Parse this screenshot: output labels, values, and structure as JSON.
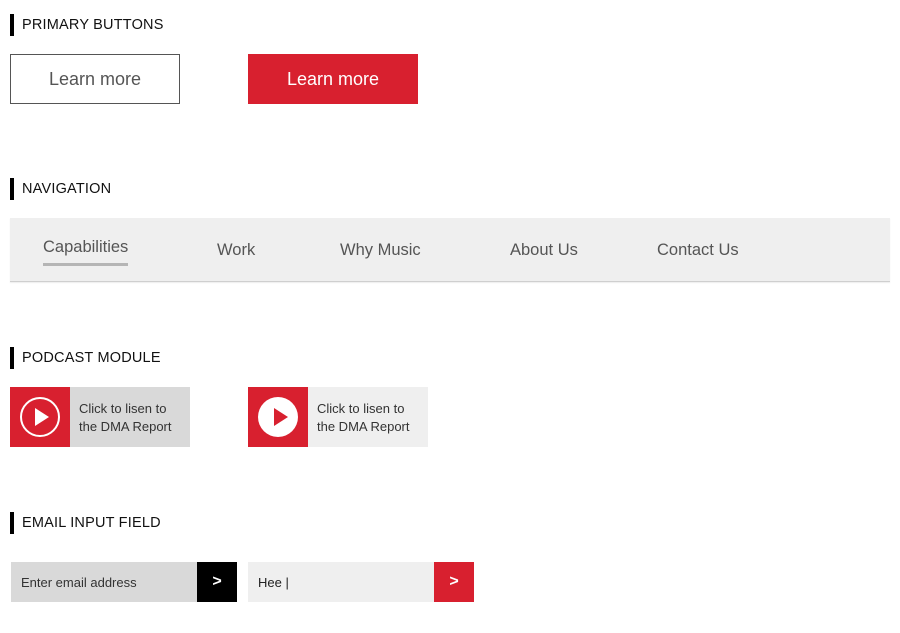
{
  "sections": {
    "primary_buttons": "PRIMARY BUTTONS",
    "navigation": "NAVIGATION",
    "podcast_module": "PODCAST MODULE",
    "email_input_field": "EMAIL INPUT FIELD"
  },
  "buttons": {
    "outline_label": "Learn more",
    "solid_label": "Learn more"
  },
  "navigation": {
    "items": [
      "Capabilities",
      "Work",
      "Why Music",
      "About Us",
      "Contact Us"
    ],
    "active_index": 0
  },
  "podcast": {
    "line1": "Click to lisen to",
    "line2": "the DMA Report",
    "icons": [
      "play-outline-icon",
      "play-filled-icon"
    ]
  },
  "email": {
    "placeholder": "Enter email address",
    "typed_value": "Hee |",
    "submit_glyph": ">"
  },
  "colors": {
    "accent_red": "#d8202f",
    "black": "#000000",
    "light_gray": "#efefef",
    "mid_gray": "#d9d9d9"
  }
}
